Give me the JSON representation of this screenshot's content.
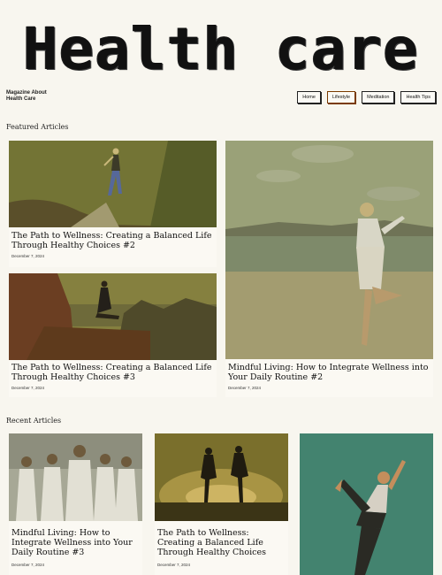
{
  "site": {
    "logo_text": "Health care",
    "tagline_line1": "Magazine About",
    "tagline_line2": "Health Care"
  },
  "nav": {
    "items": [
      {
        "label": "Home"
      },
      {
        "label": "Lifestyle"
      },
      {
        "label": "Meditation"
      },
      {
        "label": "Health Tips"
      }
    ]
  },
  "featured": {
    "heading": "Featured Articles",
    "cards": [
      {
        "title": "The Path to Wellness: Creating a Balanced Life Through Healthy Choices #2",
        "date": "December 7, 2024"
      },
      {
        "title": "The Path to Wellness: Creating a Balanced Life Through Healthy Choices #3",
        "date": "December 7, 2024"
      },
      {
        "title": "Mindful Living: How to Integrate Wellness into Your Daily Routine #2",
        "date": "December 7, 2024"
      }
    ]
  },
  "recent": {
    "heading": "Recent Articles",
    "cards": [
      {
        "title": "Mindful Living: How to Integrate Wellness into Your Daily Routine #3",
        "date": "December 7, 2024"
      },
      {
        "title": "The Path to Wellness: Creating a Balanced Life Through Healthy Choices",
        "date": "December 7, 2024"
      }
    ]
  }
}
